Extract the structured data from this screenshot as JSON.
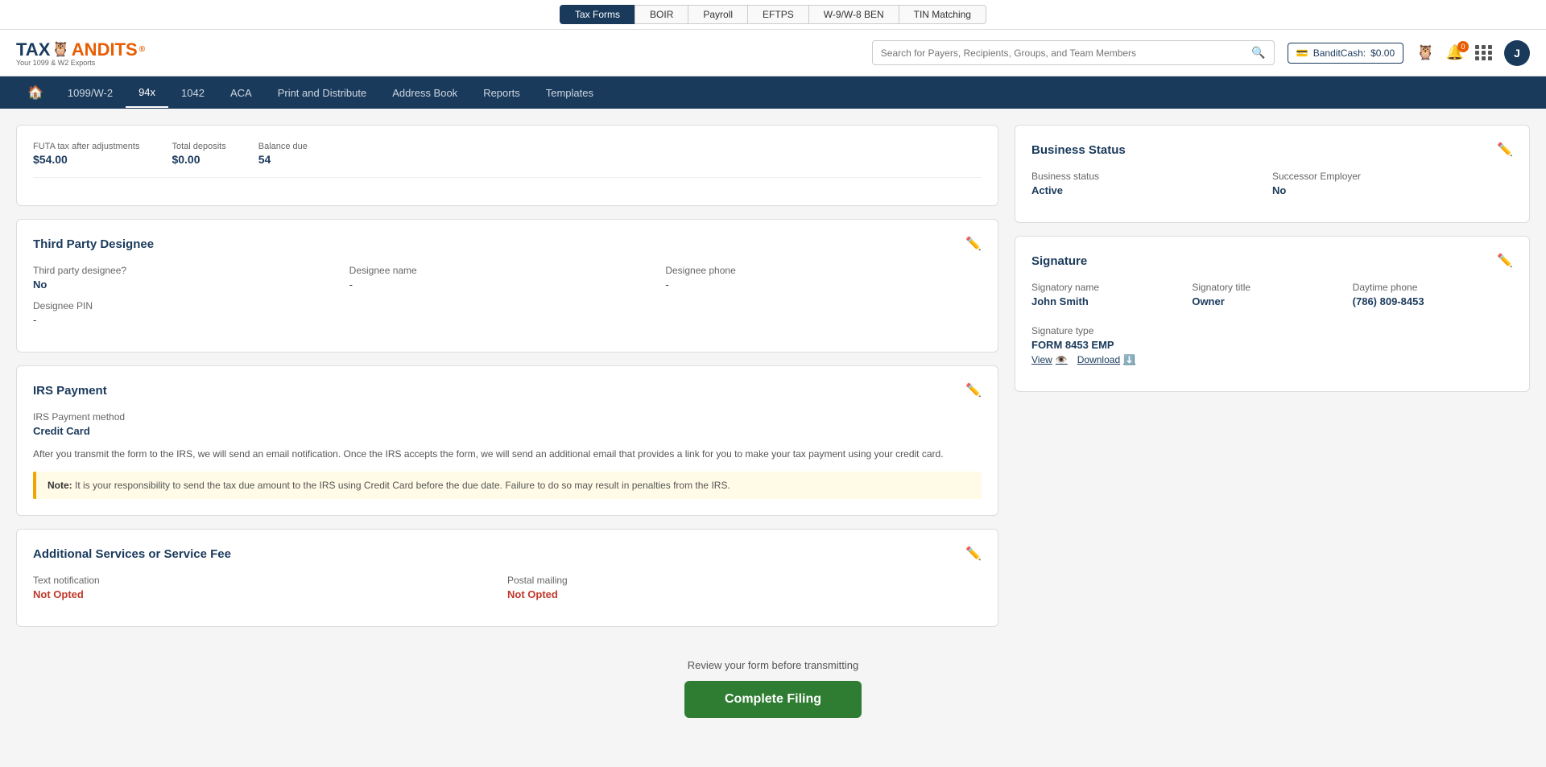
{
  "topnav": {
    "items": [
      {
        "label": "Tax Forms",
        "active": true
      },
      {
        "label": "BOIR",
        "active": false
      },
      {
        "label": "Payroll",
        "active": false
      },
      {
        "label": "EFTPS",
        "active": false
      },
      {
        "label": "W-9/W-8 BEN",
        "active": false
      },
      {
        "label": "TIN Matching",
        "active": false
      }
    ]
  },
  "header": {
    "logo_main": "TAXBANDITS",
    "logo_tm": "®",
    "logo_sub": "Your 1099 & W2 Exports",
    "search_placeholder": "Search for Payers, Recipients, Groups, and Team Members",
    "bandit_cash_label": "BanditCash:",
    "bandit_cash_value": "$0.00",
    "avatar_letter": "J"
  },
  "secondary_nav": {
    "items": [
      {
        "label": "1099/W-2",
        "active": false
      },
      {
        "label": "94x",
        "active": true
      },
      {
        "label": "1042",
        "active": false
      },
      {
        "label": "ACA",
        "active": false
      },
      {
        "label": "Print and Distribute",
        "active": false
      },
      {
        "label": "Address Book",
        "active": false
      },
      {
        "label": "Reports",
        "active": false
      },
      {
        "label": "Templates",
        "active": false
      }
    ]
  },
  "summary_bar": {
    "futa_label": "FUTA tax after adjustments",
    "futa_value": "$54.00",
    "deposits_label": "Total deposits",
    "deposits_value": "$0.00",
    "balance_label": "Balance due",
    "balance_value": "54"
  },
  "third_party": {
    "title": "Third Party Designee",
    "designee_q_label": "Third party designee?",
    "designee_q_value": "No",
    "designee_name_label": "Designee name",
    "designee_name_value": "-",
    "designee_phone_label": "Designee phone",
    "designee_phone_value": "-",
    "designee_pin_label": "Designee PIN",
    "designee_pin_value": "-"
  },
  "irs_payment": {
    "title": "IRS Payment",
    "method_label": "IRS Payment method",
    "method_value": "Credit Card",
    "description": "After you transmit the form to the IRS, we will send an email notification. Once the IRS accepts the form, we will send an additional email that provides a link for you to make your tax payment using your credit card.",
    "note_prefix": "Note:",
    "note_text": " It is your responsibility to send the tax due amount to the IRS using Credit Card before the due date. Failure to do so may result in penalties from the IRS."
  },
  "additional_services": {
    "title": "Additional Services or Service Fee",
    "text_notif_label": "Text notification",
    "text_notif_value": "Not Opted",
    "postal_label": "Postal mailing",
    "postal_value": "Not Opted"
  },
  "business_status": {
    "title": "Business Status",
    "status_label": "Business status",
    "status_value": "Active",
    "successor_label": "Successor Employer",
    "successor_value": "No"
  },
  "signature": {
    "title": "Signature",
    "name_label": "Signatory name",
    "name_value": "John Smith",
    "title_label": "Signatory title",
    "title_value": "Owner",
    "phone_label": "Daytime phone",
    "phone_value": "(786) 809-8453",
    "type_label": "Signature type",
    "type_value": "FORM 8453 EMP",
    "view_label": "View",
    "download_label": "Download"
  },
  "footer": {
    "review_text": "Review your form before transmitting",
    "btn_label": "Complete Filing"
  }
}
